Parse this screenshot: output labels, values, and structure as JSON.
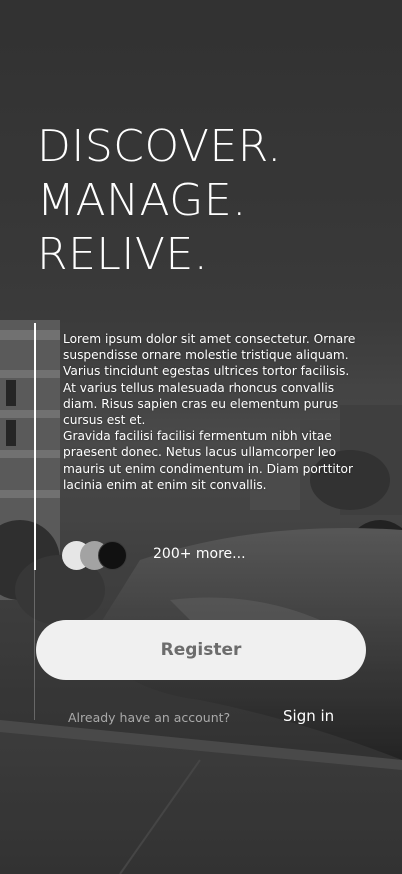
{
  "hero": {
    "lines": [
      "DISCOVER.",
      "MANAGE.",
      "RELIVE."
    ]
  },
  "description": {
    "paragraph_1": "Lorem ipsum dolor sit amet consectetur. Ornare suspendisse ornare molestie tristique aliquam. Varius tincidunt egestas ultrices tortor facilisis. At varius tellus malesuada rhoncus convallis diam. Risus sapien cras eu elementum purus cursus est et.",
    "paragraph_2": "Gravida facilisi facilisi fermentum nibh vitae praesent donec. Netus lacus ullamcorper leo mauris ut enim condimentum in. Diam porttitor lacinia enim at enim sit convallis."
  },
  "members": {
    "avatar_colors": [
      "#e6e6e6",
      "#a3a3a3",
      "#111111"
    ],
    "more_label": "200+ more..."
  },
  "actions": {
    "register_label": "Register",
    "already_label": "Already have an account?",
    "signin_label": "Sign in"
  },
  "colors": {
    "button_bg": "#f0f0f0",
    "button_text": "#6c6c6c",
    "muted_text": "#a9a9a9"
  }
}
